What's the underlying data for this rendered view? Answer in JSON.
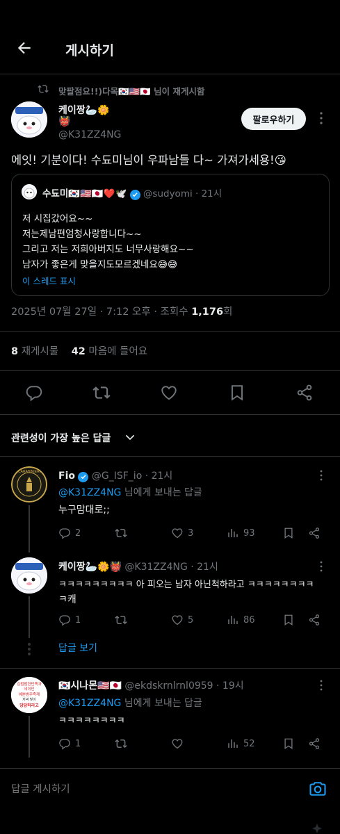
{
  "header": {
    "title": "게시하기"
  },
  "repost_banner": {
    "text": "맞팔점요!!)다목🇰🇷🇺🇸🇯🇵 님이 재게시함"
  },
  "post": {
    "display_name": "케이짱🦢🌼",
    "name_extra": "👹",
    "handle": "@K31ZZ4NG",
    "follow_label": "팔로우하기",
    "text": "에잇! 기분이다! 수됴미님이 우파남들 다~ 가져가세용!😘",
    "timestamp_prefix": "2025년 07월 27일 · 7:12 오후 · 조회수 ",
    "views": "1,176",
    "views_suffix": "회",
    "reposts_count": "8",
    "reposts_label": "재게시물",
    "likes_count": "42",
    "likes_label": "마음에 들어요"
  },
  "quote": {
    "display_name": "수됴미🇰🇷🇺🇸🇯🇵❤️🕊️",
    "handle": "@sudyomi",
    "time": "· 21시",
    "lines": [
      "저 시집갔어요~~",
      "저는제남편엄청사랑합니다~~",
      "그리고 저는 저희아버지도 너무사랑해요~~",
      "남자가 좋은게 맞을지도모르겠네요😅😅"
    ],
    "show_thread": "이 스레드 표시"
  },
  "sort": {
    "label": "관련성이 가장 높은 답글"
  },
  "replies": [
    {
      "display_name": "Fio",
      "handle": "@G_ISF_io · 21시",
      "reply_to_handle": "@K31ZZ4NG",
      "reply_to_suffix": " 님에게 보내는 답글",
      "text": "누구맘대로;;",
      "comments": "2",
      "reposts": "",
      "likes": "3",
      "views": "93"
    },
    {
      "display_name": "케이짱🦢🌼👹",
      "handle": "@K31ZZ4NG · 21시",
      "text_line1": "ㅋㅋㅋㅋㅋㅋㅋㅋㅋ 아 피오는 남자 아닌척하라고 ㅋㅋㅋㅋㅋㅋㅋㅋ",
      "text_line2": "ㅋ캐",
      "comments": "1",
      "reposts": "",
      "likes": "5",
      "views": "86",
      "show_replies": "답글 보기"
    },
    {
      "display_name": "🇰🇷시나몬🇺🇸🇯🇵",
      "handle": "@ekdskrnlrnl0959 · 19시",
      "reply_to_handle": "@K31ZZ4NG",
      "reply_to_suffix": " 님에게 보내는 답글",
      "text": "ㅋㅋㅋㅋㅋㅋㅋㅋ",
      "comments": "1",
      "reposts": "",
      "likes": "",
      "views": "52"
    }
  ],
  "avatar_texts": {
    "fio_seal": "CARABINIERI",
    "cinnamon_lines": [
      "김범범한민족과",
      "네이민",
      "예쁜범무족재",
      "저녁 빛이",
      "당당하라고"
    ]
  },
  "compose": {
    "placeholder": "답글 게시하기"
  },
  "colors": {
    "accent": "#1d9bf0",
    "background": "#000000",
    "muted": "#71767b"
  }
}
